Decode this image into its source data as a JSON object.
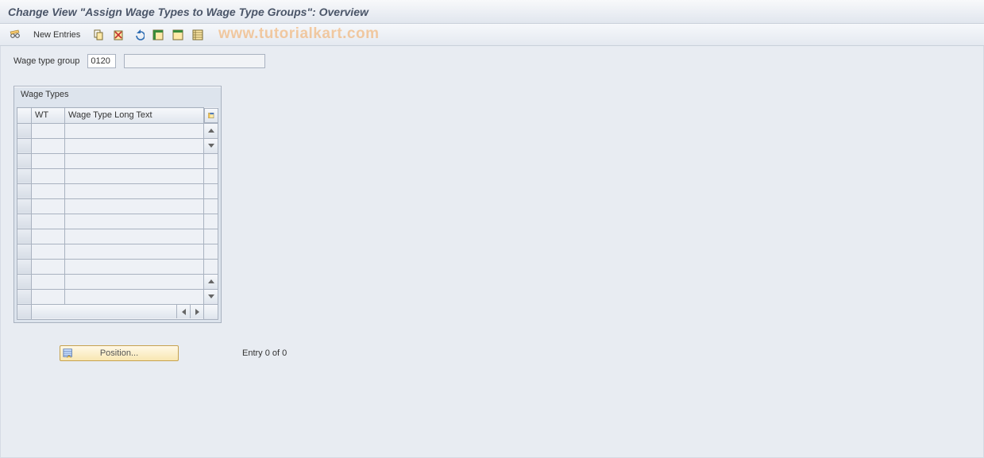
{
  "title": "Change View \"Assign Wage Types to Wage Type Groups\": Overview",
  "watermark": "www.tutorialkart.com",
  "toolbar": {
    "new_entries_label": "New Entries"
  },
  "form": {
    "wage_type_group_label": "Wage type group",
    "wage_type_group_code": "0120",
    "wage_type_group_desc": ""
  },
  "group": {
    "title": "Wage Types",
    "columns": {
      "wt": "WT",
      "long_text": "Wage Type Long Text"
    },
    "rows": [
      {
        "wt": "",
        "text": ""
      },
      {
        "wt": "",
        "text": ""
      },
      {
        "wt": "",
        "text": ""
      },
      {
        "wt": "",
        "text": ""
      },
      {
        "wt": "",
        "text": ""
      },
      {
        "wt": "",
        "text": ""
      },
      {
        "wt": "",
        "text": ""
      },
      {
        "wt": "",
        "text": ""
      },
      {
        "wt": "",
        "text": ""
      },
      {
        "wt": "",
        "text": ""
      },
      {
        "wt": "",
        "text": ""
      },
      {
        "wt": "",
        "text": ""
      }
    ]
  },
  "footer": {
    "position_label": "Position...",
    "entry_text": "Entry 0 of 0"
  }
}
